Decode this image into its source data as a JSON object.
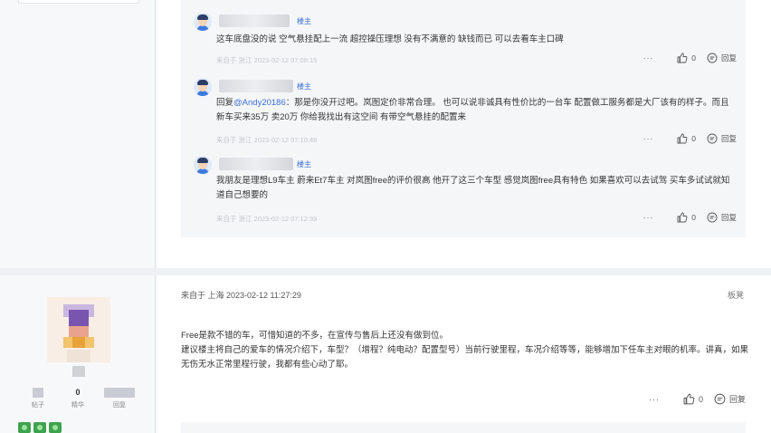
{
  "replies": [
    {
      "badge": "楼主",
      "text": "这车底盘没的说 空气悬挂配上一流 超控操压理想 没有不满意的 缺钱而已 可以去看车主口碑",
      "meta": "来自于 浙江 2023-02-12 07:08:15",
      "likes": "0",
      "reply_label": "回复"
    },
    {
      "badge": "楼主",
      "text_prefix": "回复",
      "mention": "@Andy20186",
      "text": "：那是你没开过吧。岚图定价非常合理。 也可以说非诚具有性价比的一台车 配置做工服务都是大厂该有的样子。而且新车买来35万 卖20万 你给我找出有这空间 有带空气悬挂的配置来",
      "meta": "来自于 浙江 2023-02-12 07:10:48",
      "likes": "0",
      "reply_label": "回复"
    },
    {
      "badge": "楼主",
      "text": "我朋友是理想L9车主 蔚来Et7车主 对岚图free的评价很高 他开了这三个车型 感觉岚图free具有特色 如果喜欢可以去试驾 买车多试试就知道自己想要的",
      "meta": "来自于 浙江 2023-02-12 07:12:39",
      "likes": "0",
      "reply_label": "回复"
    }
  ],
  "post2": {
    "meta": "来自于 上海 2023-02-12 11:27:29",
    "report": "板凳",
    "lines": [
      "Free是款不错的车，可惜知道的不多，在宣传与售后上还没有做到位。",
      "建议楼主将自己的爱车的情况介绍下，车型？（增程？纯电动？配置型号）当前行驶里程，车况介绍等等，能够增加下任车主对眼的机率。讲真，如果无伤无水正常里程行驶，我都有些心动了耶。"
    ],
    "likes": "0",
    "reply_label": "回复"
  },
  "profile": {
    "stats": [
      {
        "value": "",
        "label": "帖子"
      },
      {
        "value": "0",
        "label": "精华"
      },
      {
        "value": "",
        "label": "回复"
      }
    ]
  },
  "colors": {
    "accent": "#3a6fd8",
    "medal": "#3fa34d"
  },
  "icons": [
    "more-dots-icon",
    "like-icon",
    "reply-icon"
  ]
}
